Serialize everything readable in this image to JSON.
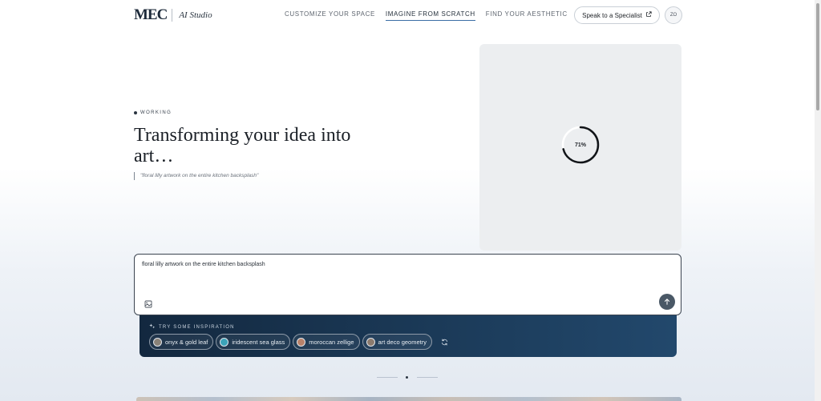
{
  "header": {
    "logo_text": "MEC",
    "logo_sub": "AI Studio",
    "nav": [
      {
        "label": "CUSTOMIZE YOUR SPACE",
        "active": false
      },
      {
        "label": "IMAGINE FROM SCRATCH",
        "active": true
      },
      {
        "label": "FIND YOUR AESTHETIC",
        "active": false
      }
    ],
    "specialist_label": "Speak to a Specialist",
    "avatar_initials": "ZO"
  },
  "hero": {
    "status": "WORKING",
    "title": "Transforming your idea into art…",
    "quote": "\"floral lilly artwork on the entire kitchen backsplash\""
  },
  "preview": {
    "progress_percent": 71,
    "progress_label": "71%"
  },
  "prompt": {
    "value": "floral lilly artwork on the entire kitchen backsplash"
  },
  "inspiration": {
    "title": "TRY SOME INSPIRATION",
    "chips": [
      {
        "label": "onyx & gold leaf",
        "color": "#8a8278"
      },
      {
        "label": "iridescent sea glass",
        "color": "#3ba3b8"
      },
      {
        "label": "moroccan zellige",
        "color": "#b9826a"
      },
      {
        "label": "art deco geometry",
        "color": "#8c7b6e"
      }
    ]
  },
  "colors": {
    "accent": "#3b6ea5",
    "panel": "#1b3a58",
    "send_button": "#4a5866"
  }
}
